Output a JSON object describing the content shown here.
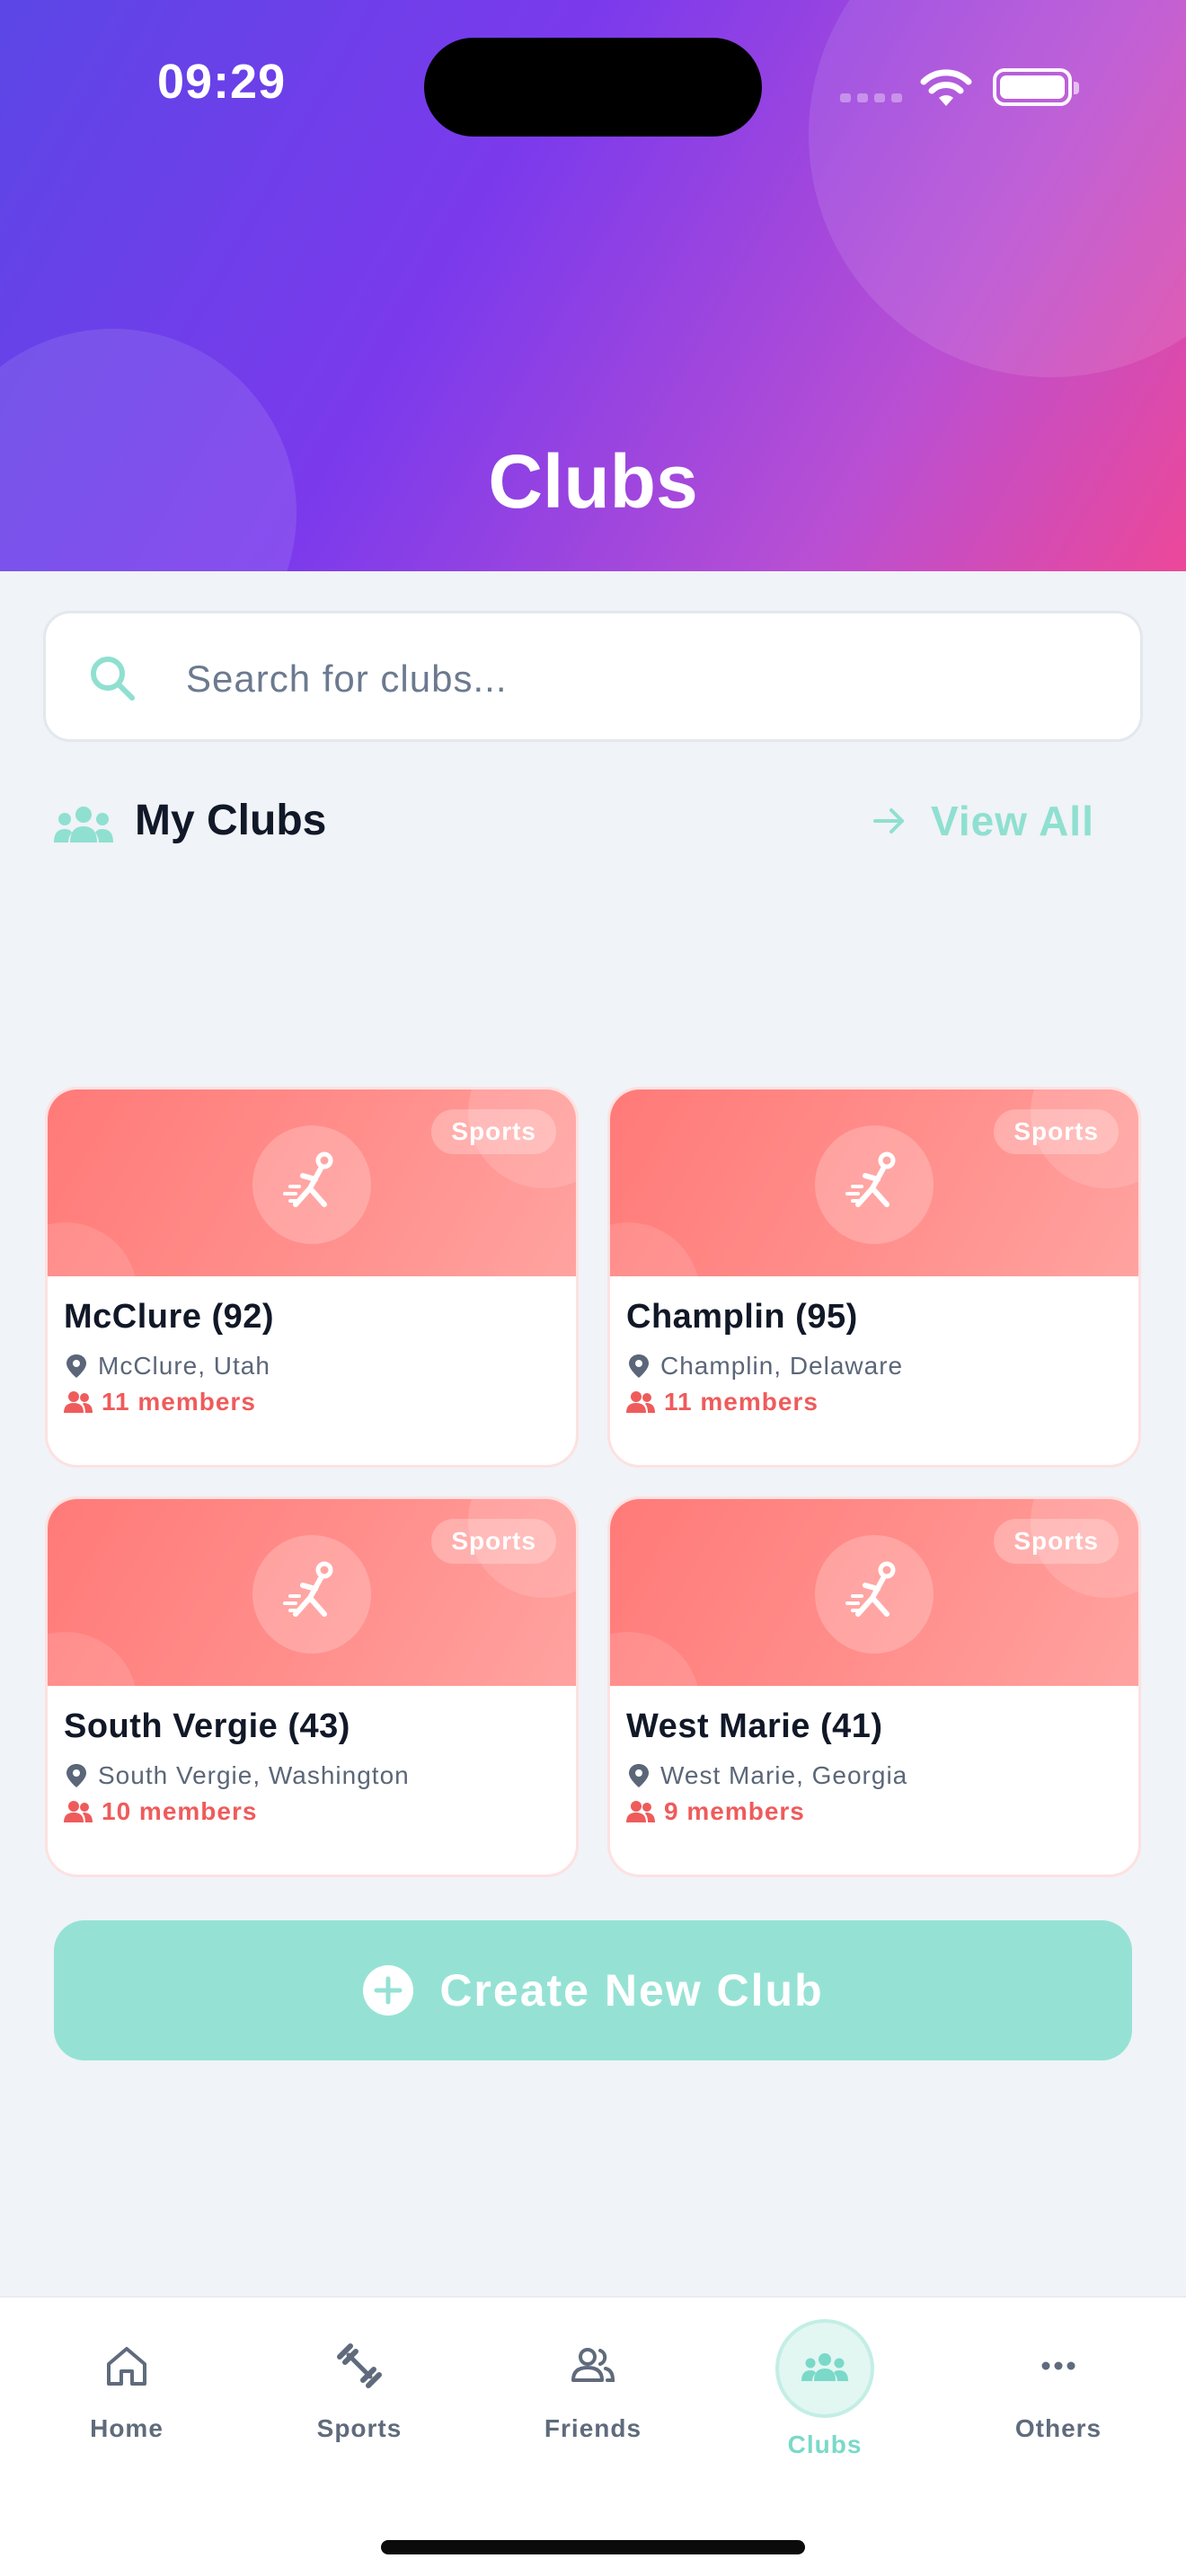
{
  "status_bar": {
    "time": "09:29"
  },
  "header": {
    "title": "Clubs"
  },
  "search": {
    "placeholder": "Search for clubs...",
    "value": ""
  },
  "my_clubs": {
    "title": "My Clubs",
    "view_all_label": "View All",
    "clubs": [
      {
        "name": "McClure (92)",
        "location": "McClure, Utah",
        "members": "11 members",
        "category": "Sports"
      },
      {
        "name": "Champlin (95)",
        "location": "Champlin, Delaware",
        "members": "11 members",
        "category": "Sports"
      },
      {
        "name": "South Vergie (43)",
        "location": "South Vergie, Washington",
        "members": "10 members",
        "category": "Sports"
      },
      {
        "name": "West Marie (41)",
        "location": "West Marie, Georgia",
        "members": "9 members",
        "category": "Sports"
      }
    ]
  },
  "actions": {
    "create_label": "Create New Club"
  },
  "tab_bar": {
    "active": "Clubs",
    "tabs": [
      {
        "label": "Home",
        "icon": "home-icon"
      },
      {
        "label": "Sports",
        "icon": "dumbbell-icon"
      },
      {
        "label": "Friends",
        "icon": "friends-icon"
      },
      {
        "label": "Clubs",
        "icon": "group-icon"
      },
      {
        "label": "Others",
        "icon": "more-icon"
      }
    ]
  },
  "colors": {
    "header_gradient": [
      "#5b46e6",
      "#7b3aec",
      "#ec4899"
    ],
    "accent_teal": "#95e2d5",
    "card_banner": "#ff7a78",
    "members_red": "#ef5b5b"
  }
}
